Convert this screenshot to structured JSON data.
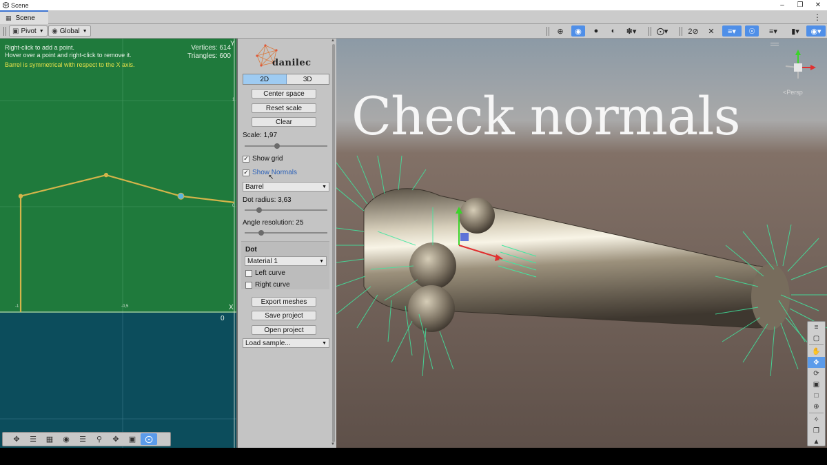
{
  "window": {
    "title": "Scene",
    "controls": [
      "minimize",
      "maximize",
      "close"
    ]
  },
  "tabs": [
    {
      "label": "Scene",
      "icon": "grid-icon"
    }
  ],
  "toolbar": {
    "pivot_label": "Pivot",
    "global_label": "Global",
    "right_icons": [
      "crosshair-icon",
      "globe-icon",
      "shaded-sphere-icon",
      "halfmoon-icon",
      "bug-icon",
      "compass-icon",
      "2d-toggle-icon",
      "light-off-icon",
      "layers-icon",
      "eye-icon",
      "stack-icon",
      "camera-icon",
      "gizmo-globe-icon"
    ]
  },
  "editor2d": {
    "help_line1": "Right-click to add a point.",
    "help_line2": "Hover over a point and right-click to remove it.",
    "symmetry_note": "Barrel is symmetrical with respect to the X axis.",
    "vertices_label": "Vertices: 614",
    "triangles_label": "Triangles: 600",
    "axis_y": "Y",
    "axis_x": "X",
    "origin_label": "0",
    "tick_minus1": "-1",
    "tick_minus05": "-0,5",
    "tick_1": "1",
    "tick_0": "0",
    "curve_points": [
      {
        "x": -1.0,
        "y": 0.0
      },
      {
        "x": -1.0,
        "y": 0.55
      },
      {
        "x": -0.6,
        "y": 0.65
      },
      {
        "x": -0.25,
        "y": 0.55
      },
      {
        "x": 0.0,
        "y": 0.52
      }
    ],
    "colors": {
      "upper_bg": "#1f7a3c",
      "lower_bg": "#0c4d5c",
      "curve": "#d4b44a",
      "selected_point": "#5ab4e0"
    }
  },
  "panel": {
    "logo_text": "danilec",
    "mode_2d": "2D",
    "mode_3d": "3D",
    "center_space": "Center space",
    "reset_scale": "Reset scale",
    "clear": "Clear",
    "scale_label": "Scale: 1,97",
    "scale_value": 0.38,
    "show_grid": "Show grid",
    "show_grid_checked": true,
    "show_normals": "Show Normals",
    "show_normals_checked": true,
    "shape_select": "Barrel",
    "dot_radius_label": "Dot radius: 3,63",
    "dot_radius_value": 0.15,
    "angle_resolution_label": "Angle resolution: 25",
    "angle_resolution_value": 0.18,
    "dot_section_title": "Dot",
    "material_select": "Material 1",
    "left_curve": "Left curve",
    "left_curve_checked": false,
    "right_curve": "Right curve",
    "right_curve_checked": false,
    "export_meshes": "Export meshes",
    "save_project": "Save project",
    "open_project": "Open project",
    "load_sample": "Load sample..."
  },
  "scene": {
    "overlay_title": "Check normals",
    "persp_label": "<Persp",
    "tool_icons": [
      "hand-icon",
      "move-icon",
      "rotate-icon",
      "scale-icon",
      "rect-icon",
      "transform-icon",
      "custom-tool-icon",
      "view-icon",
      "camera-tool-icon"
    ]
  },
  "tools2d": [
    "move-icon",
    "sliders-icon",
    "grid-off-icon",
    "globe-icon",
    "layers-icon",
    "search-icon",
    "pan-icon",
    "gallery-icon",
    "compass-icon"
  ]
}
